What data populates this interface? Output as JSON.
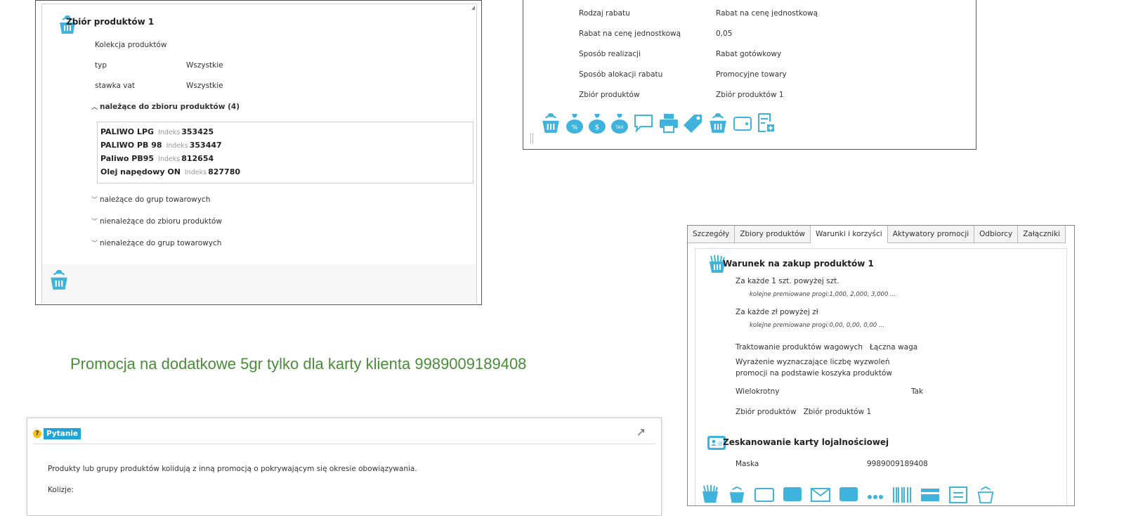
{
  "panel1": {
    "title": "Zbiór produktów 1",
    "rows": [
      {
        "label": "Kolekcja produktów",
        "value": ""
      },
      {
        "label": "typ",
        "value": "Wszystkie"
      },
      {
        "label": "stawka vat",
        "value": "Wszystkie"
      }
    ],
    "expanded_section": "należące do zbioru produktów (4)",
    "products": [
      {
        "name": "PALIWO LPG",
        "index_label": "Indeks",
        "index": "353425"
      },
      {
        "name": "PALIWO PB 98",
        "index_label": "Indeks",
        "index": "353447"
      },
      {
        "name": "Paliwo PB95",
        "index_label": "Indeks",
        "index": "812654"
      },
      {
        "name": "Olej napędowy ON",
        "index_label": "Indeks",
        "index": "827780"
      }
    ],
    "collapsed_sections": [
      "należące do grup towarowych",
      "nienależące do zbioru produktów",
      "nienależące do grup towarowych"
    ]
  },
  "panel2": {
    "rows": [
      {
        "label": "Rodzaj rabatu",
        "value": "Rabat na cenę jednostkową"
      },
      {
        "label": "Rabat na cenę jednostkową",
        "value": "0,05"
      },
      {
        "label": "Sposób realizacji",
        "value": "Rabat gotówkowy"
      },
      {
        "label": "Sposób alokacji rabatu",
        "value": "Promocyjne towary"
      },
      {
        "label": "Zbiór produktów",
        "value": "Zbiór produktów 1"
      }
    ],
    "toolbar_icons": [
      "basket-icon",
      "bag-percent-icon",
      "bag-dollar-icon",
      "bag-tax-icon",
      "chat-icon",
      "printer-icon",
      "tag-icon",
      "basket-icon",
      "wallet-icon",
      "document-add-icon"
    ]
  },
  "heading": "Promocja na dodatkowe 5gr tylko dla karty klienta 9989009189408",
  "panel3": {
    "tabs": [
      "Szczegóły",
      "Zbiory produktów",
      "Warunki i korzyści",
      "Aktywatory promocji",
      "Odbiorcy",
      "Załączniki"
    ],
    "active_tab": 2,
    "condition_title": "Warunek na zakup produktów 1",
    "lines": [
      "Za każde 1 szt. powyżej  szt.",
      "kolejne premiowane progi:1,000, 2,000, 3,000 ...",
      "Za każde  zł powyżej  zł",
      "kolejne premiowane progi:0,00, 0,00, 0,00 ...",
      "Traktowanie produktów wagowych",
      "Łączna waga",
      "Wyrażenie wyznaczające liczbę wyzwoleń",
      "promocji na podstawie koszyka produktów",
      "Wielokrotny",
      "Tak",
      "Zbiór produktów",
      "Zbiór produktów 1"
    ],
    "card_title": "Zeskanowanie karty lojalnościowej",
    "mask_label": "Maska",
    "mask_value": "9989009189408"
  },
  "dialog": {
    "title": "Pytanie",
    "message": "Produkty lub grupy produktów kolidują z inną promocją o pokrywającym się okresie obowiązywania.",
    "collisions_label": "Kolizje:"
  },
  "colors": {
    "icon_blue": "#3fb3dc",
    "heading_green": "#4a8c3a",
    "dialog_title_bg": "#1da5d7"
  }
}
